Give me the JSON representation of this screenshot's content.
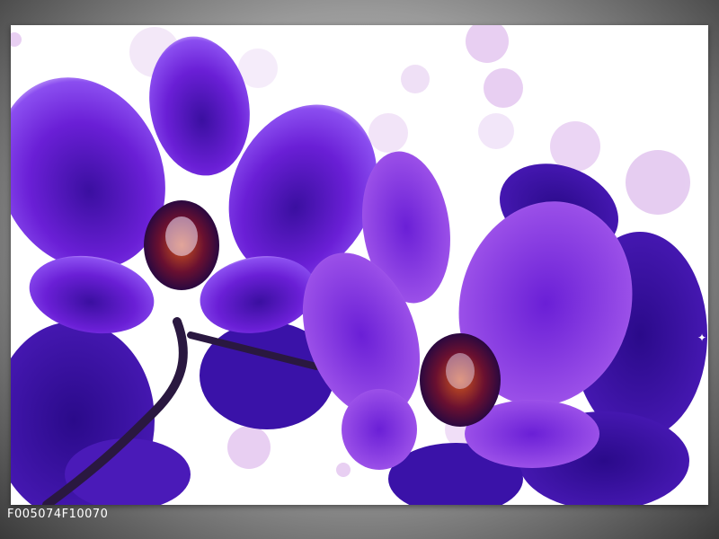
{
  "product_code": "F005074F10070",
  "colors": {
    "frame_dark": "#3a3a3a",
    "frame_light": "#cfcfcf",
    "canvas_bg": "#ffffff",
    "petal_violet": "#6a1fd6",
    "petal_deep": "#3a0fa0",
    "petal_light": "#c9a6ff",
    "bokeh": "#d6a8e8",
    "stem": "#2a1840",
    "throat": "#b8421a"
  }
}
